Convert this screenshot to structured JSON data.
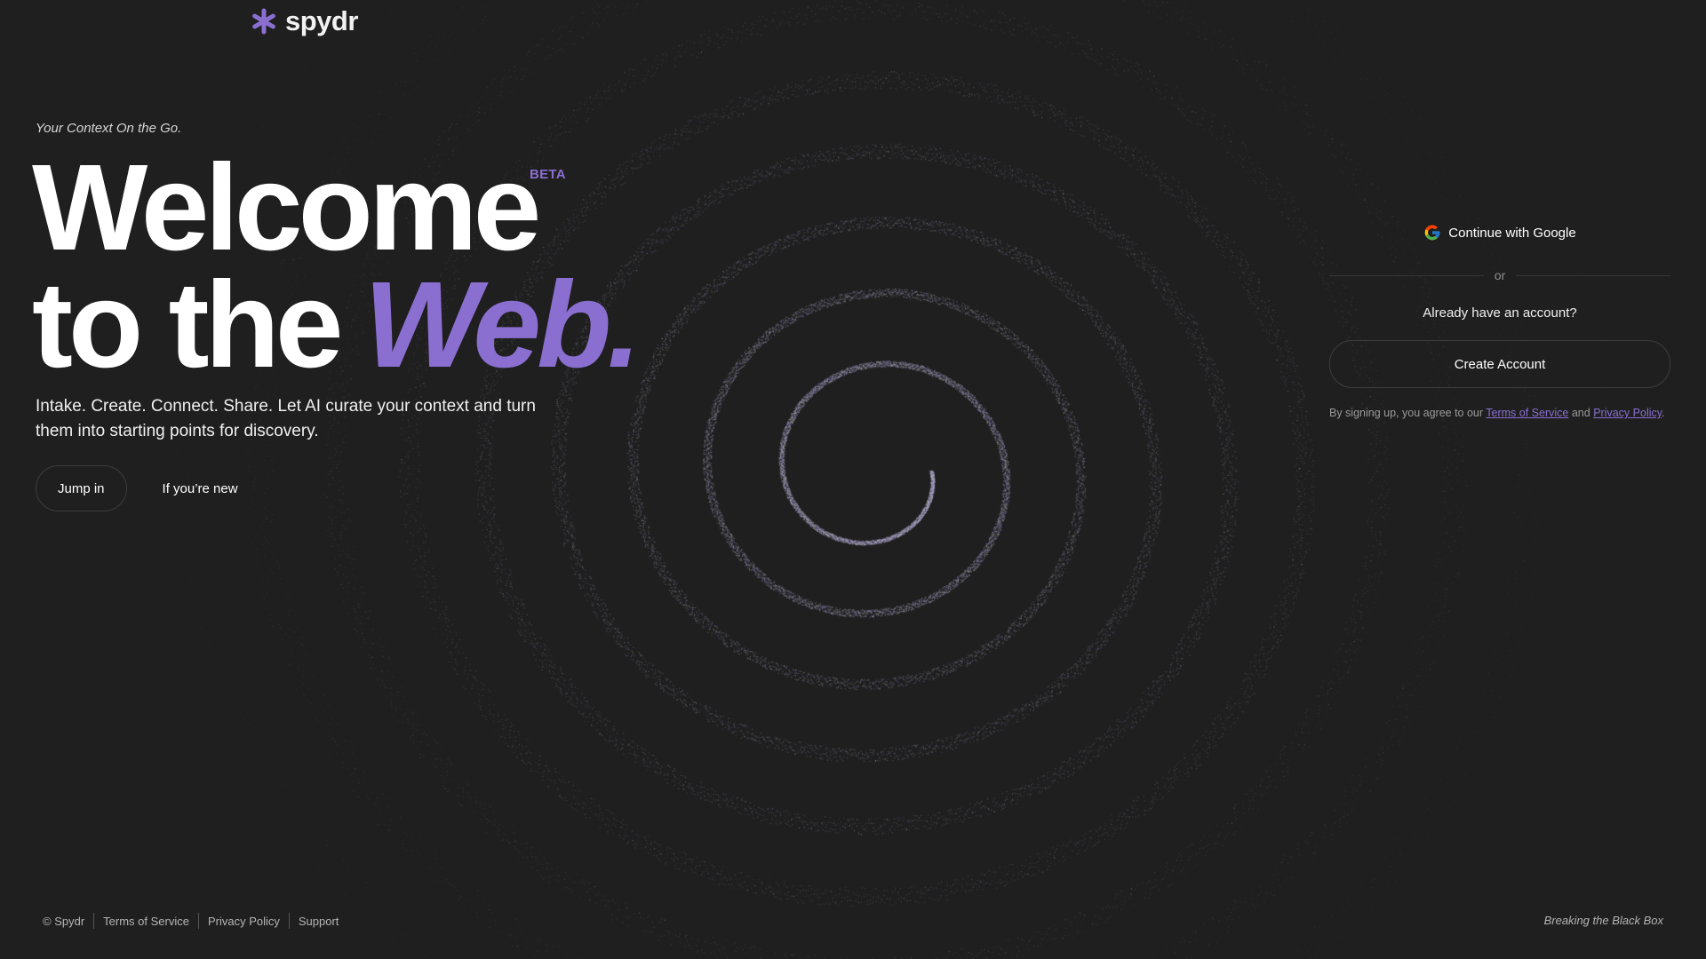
{
  "brand": {
    "name": "spydr",
    "accent_color": "#8a6fd1",
    "icon": "asterisk-logo-icon"
  },
  "hero": {
    "tagline": "Your Context On the Go.",
    "line1": "Welcome",
    "line2_prefix": "to the",
    "line2_accent": "Web.",
    "badge": "BETA",
    "subtitle": "Intake. Create. Connect. Share. Let AI curate your context and turn them into starting points for discovery."
  },
  "cta": {
    "primary_label": "Jump in",
    "secondary_label": "If you’re new"
  },
  "auth": {
    "google_label": "Continue with Google",
    "divider_text": "or",
    "have_account_text": "Already have an account?",
    "create_account_label": "Create Account",
    "legal_prefix": "By signing up, you agree to our",
    "terms_link": "Terms of Service",
    "legal_and": "and",
    "privacy_link": "Privacy Policy",
    "legal_suffix": "."
  },
  "footer": {
    "copyright": "© Spydr",
    "links": [
      "Terms of Service",
      "Privacy Policy",
      "Support"
    ],
    "slogan": "Breaking the Black Box"
  }
}
